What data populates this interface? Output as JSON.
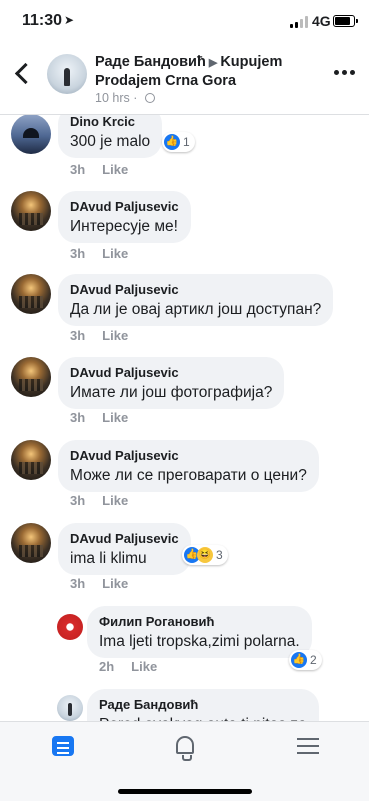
{
  "status_bar": {
    "time": "11:30",
    "network": "4G"
  },
  "header": {
    "author": "Раде Бандовић",
    "group": "Kupujem Prodajem Crna Gora",
    "time_ago": "10 hrs",
    "icons": {
      "back": "chevron-left-icon",
      "privacy": "globe-icon",
      "more": "more-icon"
    }
  },
  "comments": [
    {
      "name": "Dino Krcic",
      "text": "300 je malo",
      "time": "3h",
      "like_label": "Like",
      "reactions": {
        "types": [
          "like"
        ],
        "count": "1"
      }
    },
    {
      "name": "DAvud Paljusevic",
      "text": "Интересује ме!",
      "time": "3h",
      "like_label": "Like"
    },
    {
      "name": "DAvud Paljusevic",
      "text": "Да ли је овај артикл још доступан?",
      "time": "3h",
      "like_label": "Like"
    },
    {
      "name": "DAvud Paljusevic",
      "text": "Имате ли још фотографија?",
      "time": "3h",
      "like_label": "Like"
    },
    {
      "name": "DAvud Paljusevic",
      "text": "Може ли се преговарати о цени?",
      "time": "3h",
      "like_label": "Like"
    },
    {
      "name": "DAvud Paljusevic",
      "text": "ima li klimu",
      "time": "3h",
      "like_label": "Like",
      "reactions": {
        "types": [
          "like",
          "haha"
        ],
        "count": "3"
      }
    }
  ],
  "replies": [
    {
      "name": "Филип Рогановић",
      "text": "Ima ljeti tropska,zimi polarna.",
      "time": "2h",
      "like_label": "Like",
      "reactions": {
        "types": [
          "like"
        ],
        "count": "2"
      }
    },
    {
      "name": "Раде Бандовић",
      "text": "Pored ovakvog auta ti pitas za"
    }
  ],
  "tab_bar": {
    "items": [
      "feed-icon",
      "bell-icon",
      "menu-icon"
    ],
    "active": "feed-icon"
  },
  "colors": {
    "accent": "#1877f2",
    "bubble": "#f0f2f5",
    "meta": "#90949c"
  }
}
